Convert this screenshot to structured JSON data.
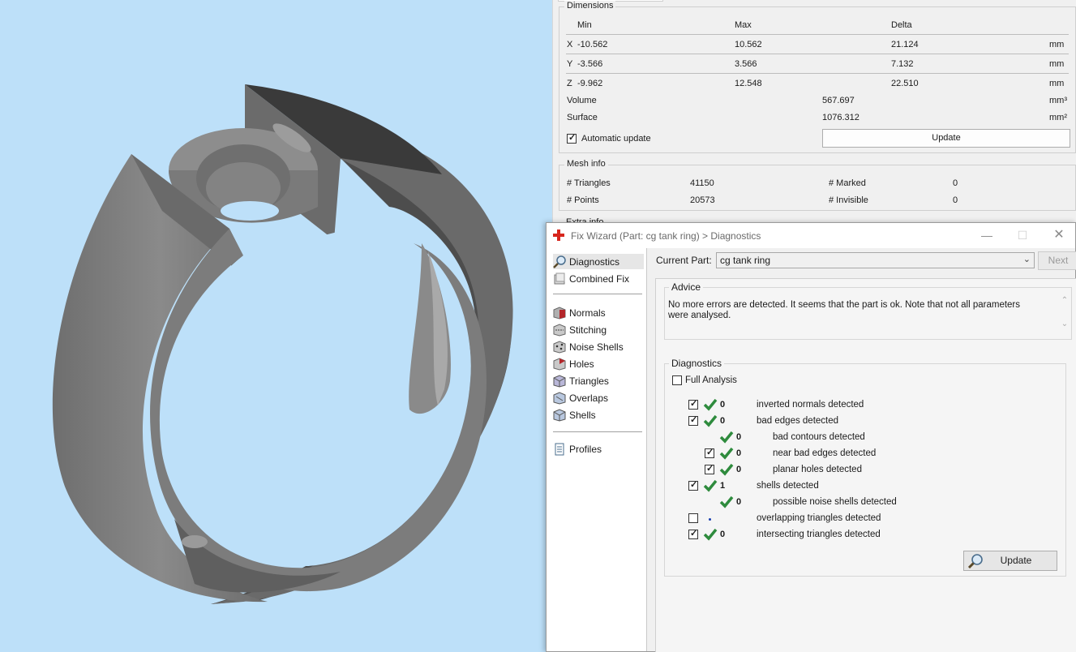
{
  "dimensions": {
    "title": "Dimensions",
    "headers": {
      "min": "Min",
      "max": "Max",
      "delta": "Delta"
    },
    "rows": [
      {
        "axis": "X",
        "min": "-10.562",
        "max": "10.562",
        "delta": "21.124",
        "unit": "mm"
      },
      {
        "axis": "Y",
        "min": "-3.566",
        "max": "3.566",
        "delta": "7.132",
        "unit": "mm"
      },
      {
        "axis": "Z",
        "min": "-9.962",
        "max": "12.548",
        "delta": "22.510",
        "unit": "mm"
      }
    ],
    "volume_label": "Volume",
    "volume_value": "567.697",
    "volume_unit": "mm³",
    "surface_label": "Surface",
    "surface_value": "1076.312",
    "surface_unit": "mm²",
    "auto_update_label": "Automatic update",
    "auto_update_checked": true,
    "update_button": "Update"
  },
  "mesh_info": {
    "title": "Mesh info",
    "triangles_label": "# Triangles",
    "triangles_value": "41150",
    "points_label": "# Points",
    "points_value": "20573",
    "marked_label": "# Marked",
    "marked_value": "0",
    "invisible_label": "# Invisible",
    "invisible_value": "0",
    "extra_label": "Extra info"
  },
  "wizard": {
    "title": "Fix Wizard (Part: cg tank ring) > Diagnostics",
    "nav": {
      "top": [
        "Diagnostics",
        "Combined Fix"
      ],
      "tools": [
        "Normals",
        "Stitching",
        "Noise Shells",
        "Holes",
        "Triangles",
        "Overlaps",
        "Shells"
      ],
      "bottom": [
        "Profiles"
      ],
      "selected": "Diagnostics"
    },
    "current_part_label": "Current Part:",
    "current_part_value": "cg tank ring",
    "next_button": "Next",
    "advice_title": "Advice",
    "advice_text": "No more errors are detected. It seems that the part is ok. Note that not all parameters were analysed.",
    "diagnostics_title": "Diagnostics",
    "full_analysis_label": "Full Analysis",
    "full_analysis_checked": false,
    "items": [
      {
        "checked": true,
        "status": "ok",
        "count": "0",
        "label": "inverted normals detected",
        "indent": 0
      },
      {
        "checked": true,
        "status": "ok",
        "count": "0",
        "label": "bad edges detected",
        "indent": 0
      },
      {
        "checked": null,
        "status": "ok",
        "count": "0",
        "label": "bad contours detected",
        "indent": 1
      },
      {
        "checked": true,
        "status": "ok",
        "count": "0",
        "label": "near bad edges detected",
        "indent": 1
      },
      {
        "checked": true,
        "status": "ok",
        "count": "0",
        "label": "planar holes detected",
        "indent": 1
      },
      {
        "checked": true,
        "status": "ok",
        "count": "1",
        "label": "shells detected",
        "indent": 0
      },
      {
        "checked": null,
        "status": "ok",
        "count": "0",
        "label": "possible noise shells detected",
        "indent": 1
      },
      {
        "checked": false,
        "status": "pending",
        "count": "",
        "label": "overlapping triangles detected",
        "indent": 0
      },
      {
        "checked": true,
        "status": "ok",
        "count": "0",
        "label": "intersecting triangles detected",
        "indent": 0
      }
    ],
    "update_button": "Update"
  },
  "colors": {
    "viewport_bg": "#bde0f9",
    "ok_check": "#2e8b3d",
    "accent_red": "#d7261d"
  }
}
